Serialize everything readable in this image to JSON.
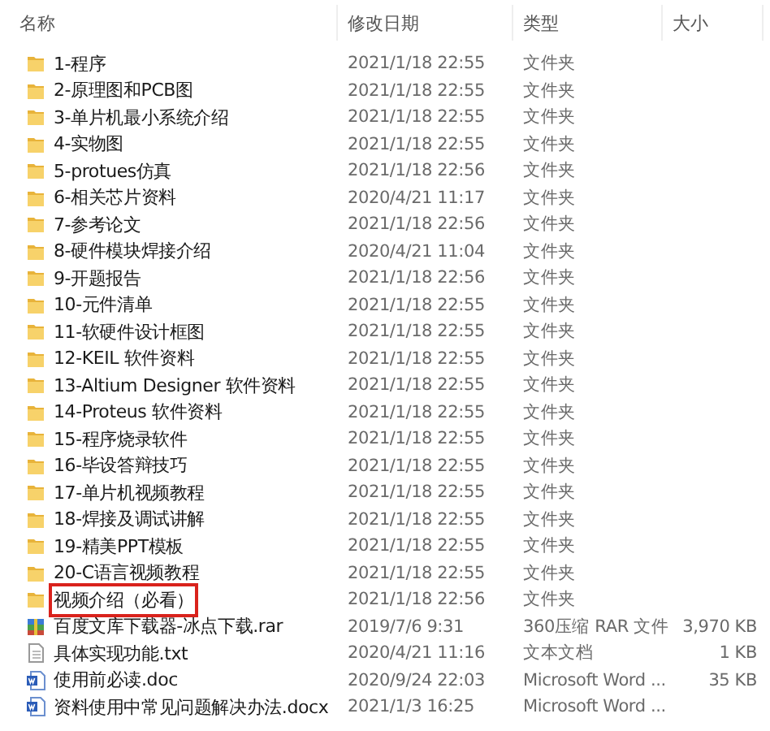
{
  "columns": [
    "名称",
    "修改日期",
    "类型",
    "大小"
  ],
  "rows": [
    {
      "kind": "folder",
      "name": "1-程序",
      "date": "2021/1/18 22:55",
      "type": "文件夹",
      "highlighted": false
    },
    {
      "kind": "folder",
      "name": "2-原理图和PCB图",
      "date": "2021/1/18 22:55",
      "type": "文件夹",
      "highlighted": false
    },
    {
      "kind": "folder",
      "name": "3-单片机最小系统介绍",
      "date": "2021/1/18 22:55",
      "type": "文件夹",
      "highlighted": false
    },
    {
      "kind": "folder",
      "name": "4-实物图",
      "date": "2021/1/18 22:55",
      "type": "文件夹",
      "highlighted": false
    },
    {
      "kind": "folder",
      "name": "5-protues仿真",
      "date": "2021/1/18 22:56",
      "type": "文件夹",
      "highlighted": false
    },
    {
      "kind": "folder",
      "name": "6-相关芯片资料",
      "date": "2020/4/21 11:17",
      "type": "文件夹",
      "highlighted": false
    },
    {
      "kind": "folder",
      "name": "7-参考论文",
      "date": "2021/1/18 22:56",
      "type": "文件夹",
      "highlighted": false
    },
    {
      "kind": "folder",
      "name": "8-硬件模块焊接介绍",
      "date": "2020/4/21 11:04",
      "type": "文件夹",
      "highlighted": false
    },
    {
      "kind": "folder",
      "name": "9-开题报告",
      "date": "2021/1/18 22:56",
      "type": "文件夹",
      "highlighted": false
    },
    {
      "kind": "folder",
      "name": "10-元件清单",
      "date": "2021/1/18 22:55",
      "type": "文件夹",
      "highlighted": false
    },
    {
      "kind": "folder",
      "name": "11-软硬件设计框图",
      "date": "2021/1/18 22:55",
      "type": "文件夹",
      "highlighted": false
    },
    {
      "kind": "folder",
      "name": "12-KEIL 软件资料",
      "date": "2021/1/18 22:55",
      "type": "文件夹",
      "highlighted": false
    },
    {
      "kind": "folder",
      "name": "13-Altium Designer 软件资料",
      "date": "2021/1/18 22:55",
      "type": "文件夹",
      "highlighted": false
    },
    {
      "kind": "folder",
      "name": "14-Proteus 软件资料",
      "date": "2021/1/18 22:55",
      "type": "文件夹",
      "highlighted": false
    },
    {
      "kind": "folder",
      "name": "15-程序烧录软件",
      "date": "2021/1/18 22:55",
      "type": "文件夹",
      "highlighted": false
    },
    {
      "kind": "folder",
      "name": "16-毕设答辩技巧",
      "date": "2021/1/18 22:55",
      "type": "文件夹",
      "highlighted": false
    },
    {
      "kind": "folder",
      "name": "17-单片机视频教程",
      "date": "2021/1/18 22:55",
      "type": "文件夹",
      "highlighted": false
    },
    {
      "kind": "folder",
      "name": "18-焊接及调试讲解",
      "date": "2021/1/18 22:55",
      "type": "文件夹",
      "highlighted": false
    },
    {
      "kind": "folder",
      "name": "19-精美PPT模板",
      "date": "2021/1/18 22:55",
      "type": "文件夹",
      "highlighted": false
    },
    {
      "kind": "folder",
      "name": "20-C语言视频教程",
      "date": "2021/1/18 22:55",
      "type": "文件夹",
      "highlighted": false
    },
    {
      "kind": "folder",
      "name": "视频介绍（必看）",
      "date": "2021/1/18 22:56",
      "type": "文件夹",
      "highlighted": true
    },
    {
      "kind": "archive",
      "name": "百度文库下载器-冰点下载.rar",
      "date": "2019/7/6 9:31",
      "type": "360压缩 RAR 文件",
      "size": "3,970 KB",
      "highlighted": false
    },
    {
      "kind": "text",
      "name": "具体实现功能.txt",
      "date": "2020/4/21 11:16",
      "type": "文本文档",
      "size": "1 KB",
      "highlighted": false
    },
    {
      "kind": "word",
      "name": "使用前必读.doc",
      "date": "2020/9/24 22:03",
      "type": "Microsoft Word ...",
      "size": "35 KB",
      "highlighted": false
    },
    {
      "kind": "word",
      "name": "资料使用中常见问题解决办法.docx",
      "date": "2021/1/3 16:25",
      "type": "Microsoft Word ...",
      "highlighted": false
    }
  ]
}
